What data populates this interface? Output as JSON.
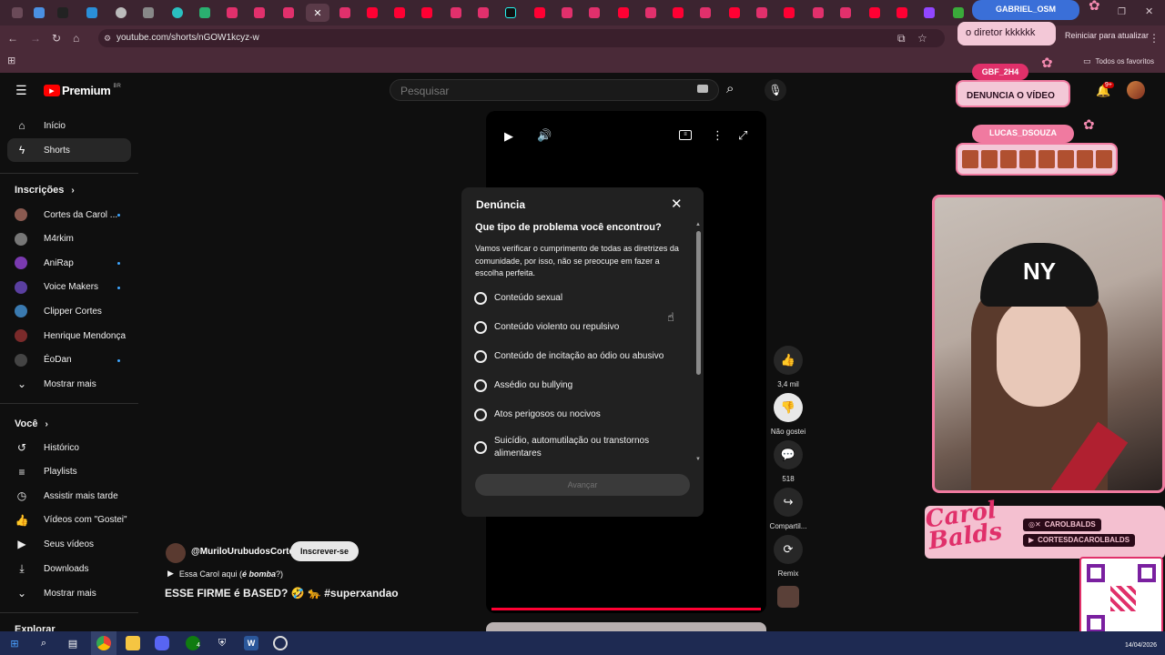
{
  "browser": {
    "url": "youtube.com/shorts/nGOW1kcyz-w",
    "update_button": "Reiniciar para atualizar",
    "bookmarks_all": "Todos os favoritos"
  },
  "youtube": {
    "brand": "Premium",
    "region": "BR",
    "search_placeholder": "Pesquisar",
    "notifications_badge": "9+"
  },
  "sidebar": {
    "primary": [
      {
        "label": "Início",
        "icon": "home-icon"
      },
      {
        "label": "Shorts",
        "icon": "shorts-icon"
      }
    ],
    "subscriptions_header": "Inscrições",
    "subscriptions": [
      {
        "label": "Cortes da Carol ...",
        "color": "#8a5a50",
        "dot": true
      },
      {
        "label": "M4rkim",
        "color": "#777777",
        "dot": false
      },
      {
        "label": "AniRap",
        "color": "#7a3ab0",
        "dot": true
      },
      {
        "label": "Voice Makers",
        "color": "#5a3fa0",
        "dot": true
      },
      {
        "label": "Clipper Cortes",
        "color": "#3a7ab0",
        "dot": false
      },
      {
        "label": "Henrique Mendonça",
        "color": "#7a2a2a",
        "dot": false
      },
      {
        "label": "ÉoDan",
        "color": "#444444",
        "dot": true
      }
    ],
    "show_more_1": "Mostrar mais",
    "you_header": "Você",
    "you_items": [
      {
        "label": "Histórico",
        "icon": "history-icon"
      },
      {
        "label": "Playlists",
        "icon": "playlists-icon"
      },
      {
        "label": "Assistir mais tarde",
        "icon": "clock-icon"
      },
      {
        "label": "Vídeos com \"Gostei\"",
        "icon": "thumbs-up-icon"
      },
      {
        "label": "Seus vídeos",
        "icon": "video-icon"
      },
      {
        "label": "Downloads",
        "icon": "download-icon"
      }
    ],
    "show_more_2": "Mostrar mais",
    "explore_header": "Explorar"
  },
  "short": {
    "channel": "@MuriloUrubudosCortes",
    "subscribe": "Inscrever-se",
    "audio_prefix": "Essa Carol aqui (",
    "audio_italic": "é bomba",
    "audio_suffix": "?)",
    "title": "ESSE FIRME é BASED? 🤣 🐆 #superxandao",
    "likes": "3,4 mil",
    "dislike": "Não gostei",
    "comments": "518",
    "share": "Compartil...",
    "remix": "Remix",
    "progress": 1.0
  },
  "report_dialog": {
    "title": "Denúncia",
    "question": "Que tipo de problema você encontrou?",
    "description": "Vamos verificar o cumprimento de todas as diretrizes da comunidade, por isso, não se preocupe em fazer a escolha perfeita.",
    "options": [
      "Conteúdo sexual",
      "Conteúdo violento ou repulsivo",
      "Conteúdo de incitação ao ódio ou abusivo",
      "Assédio ou bullying",
      "Atos perigosos ou nocivos",
      "Suicídio, automutilação ou transtornos alimentares"
    ],
    "next_button": "Avançar"
  },
  "stream_overlay": {
    "chat1_user": "GABRIEL_OSM",
    "chat1_msg": "o diretor kkkkkk",
    "chat2_user": "GBF_2H4",
    "chat2_msg": "DENUNCIA O VÍDEO",
    "chat3_user": "LUCAS_DSOUZA",
    "logo_text": "Carol Balds",
    "social_1": "CAROLBALDS",
    "social_2": "CORTESDACAROLBALDS",
    "cap_text": "NY"
  },
  "taskbar": {
    "date": "14/04/2026",
    "xbox_badge": "4"
  },
  "colors": {
    "youtube_red": "#ff0000",
    "overlay_pink": "#e0306a",
    "cam_border": "#f07aa0"
  }
}
